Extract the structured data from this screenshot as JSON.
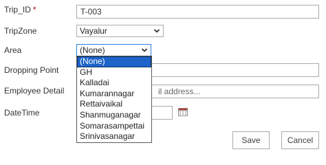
{
  "form": {
    "trip_id": {
      "label": "Trip_ID",
      "required_mark": "*",
      "value": "T-003"
    },
    "trip_zone": {
      "label": "TripZone",
      "value": "Vayalur"
    },
    "area": {
      "label": "Area",
      "value": "(None)",
      "options": [
        "(None)",
        "GH",
        "Kalladai",
        "Kumarannagar",
        "Rettaivaikal",
        "Shanmuganagar",
        "Somarasampettai",
        "Srinivasanagar"
      ],
      "selected_index": 0
    },
    "dropping_point": {
      "label": "Dropping Point",
      "value": ""
    },
    "employee_detail": {
      "label": "Employee Detail",
      "placeholder_visible": "il address..."
    },
    "datetime": {
      "label": "DateTime",
      "value": ""
    }
  },
  "buttons": {
    "save": "Save",
    "cancel": "Cancel"
  },
  "icons": {
    "chevron": "chevron-down-icon",
    "calendar": "calendar-icon"
  },
  "colors": {
    "selected_bg": "#1e64c8",
    "focus_border": "#2b7bd6",
    "required": "#a80000"
  }
}
